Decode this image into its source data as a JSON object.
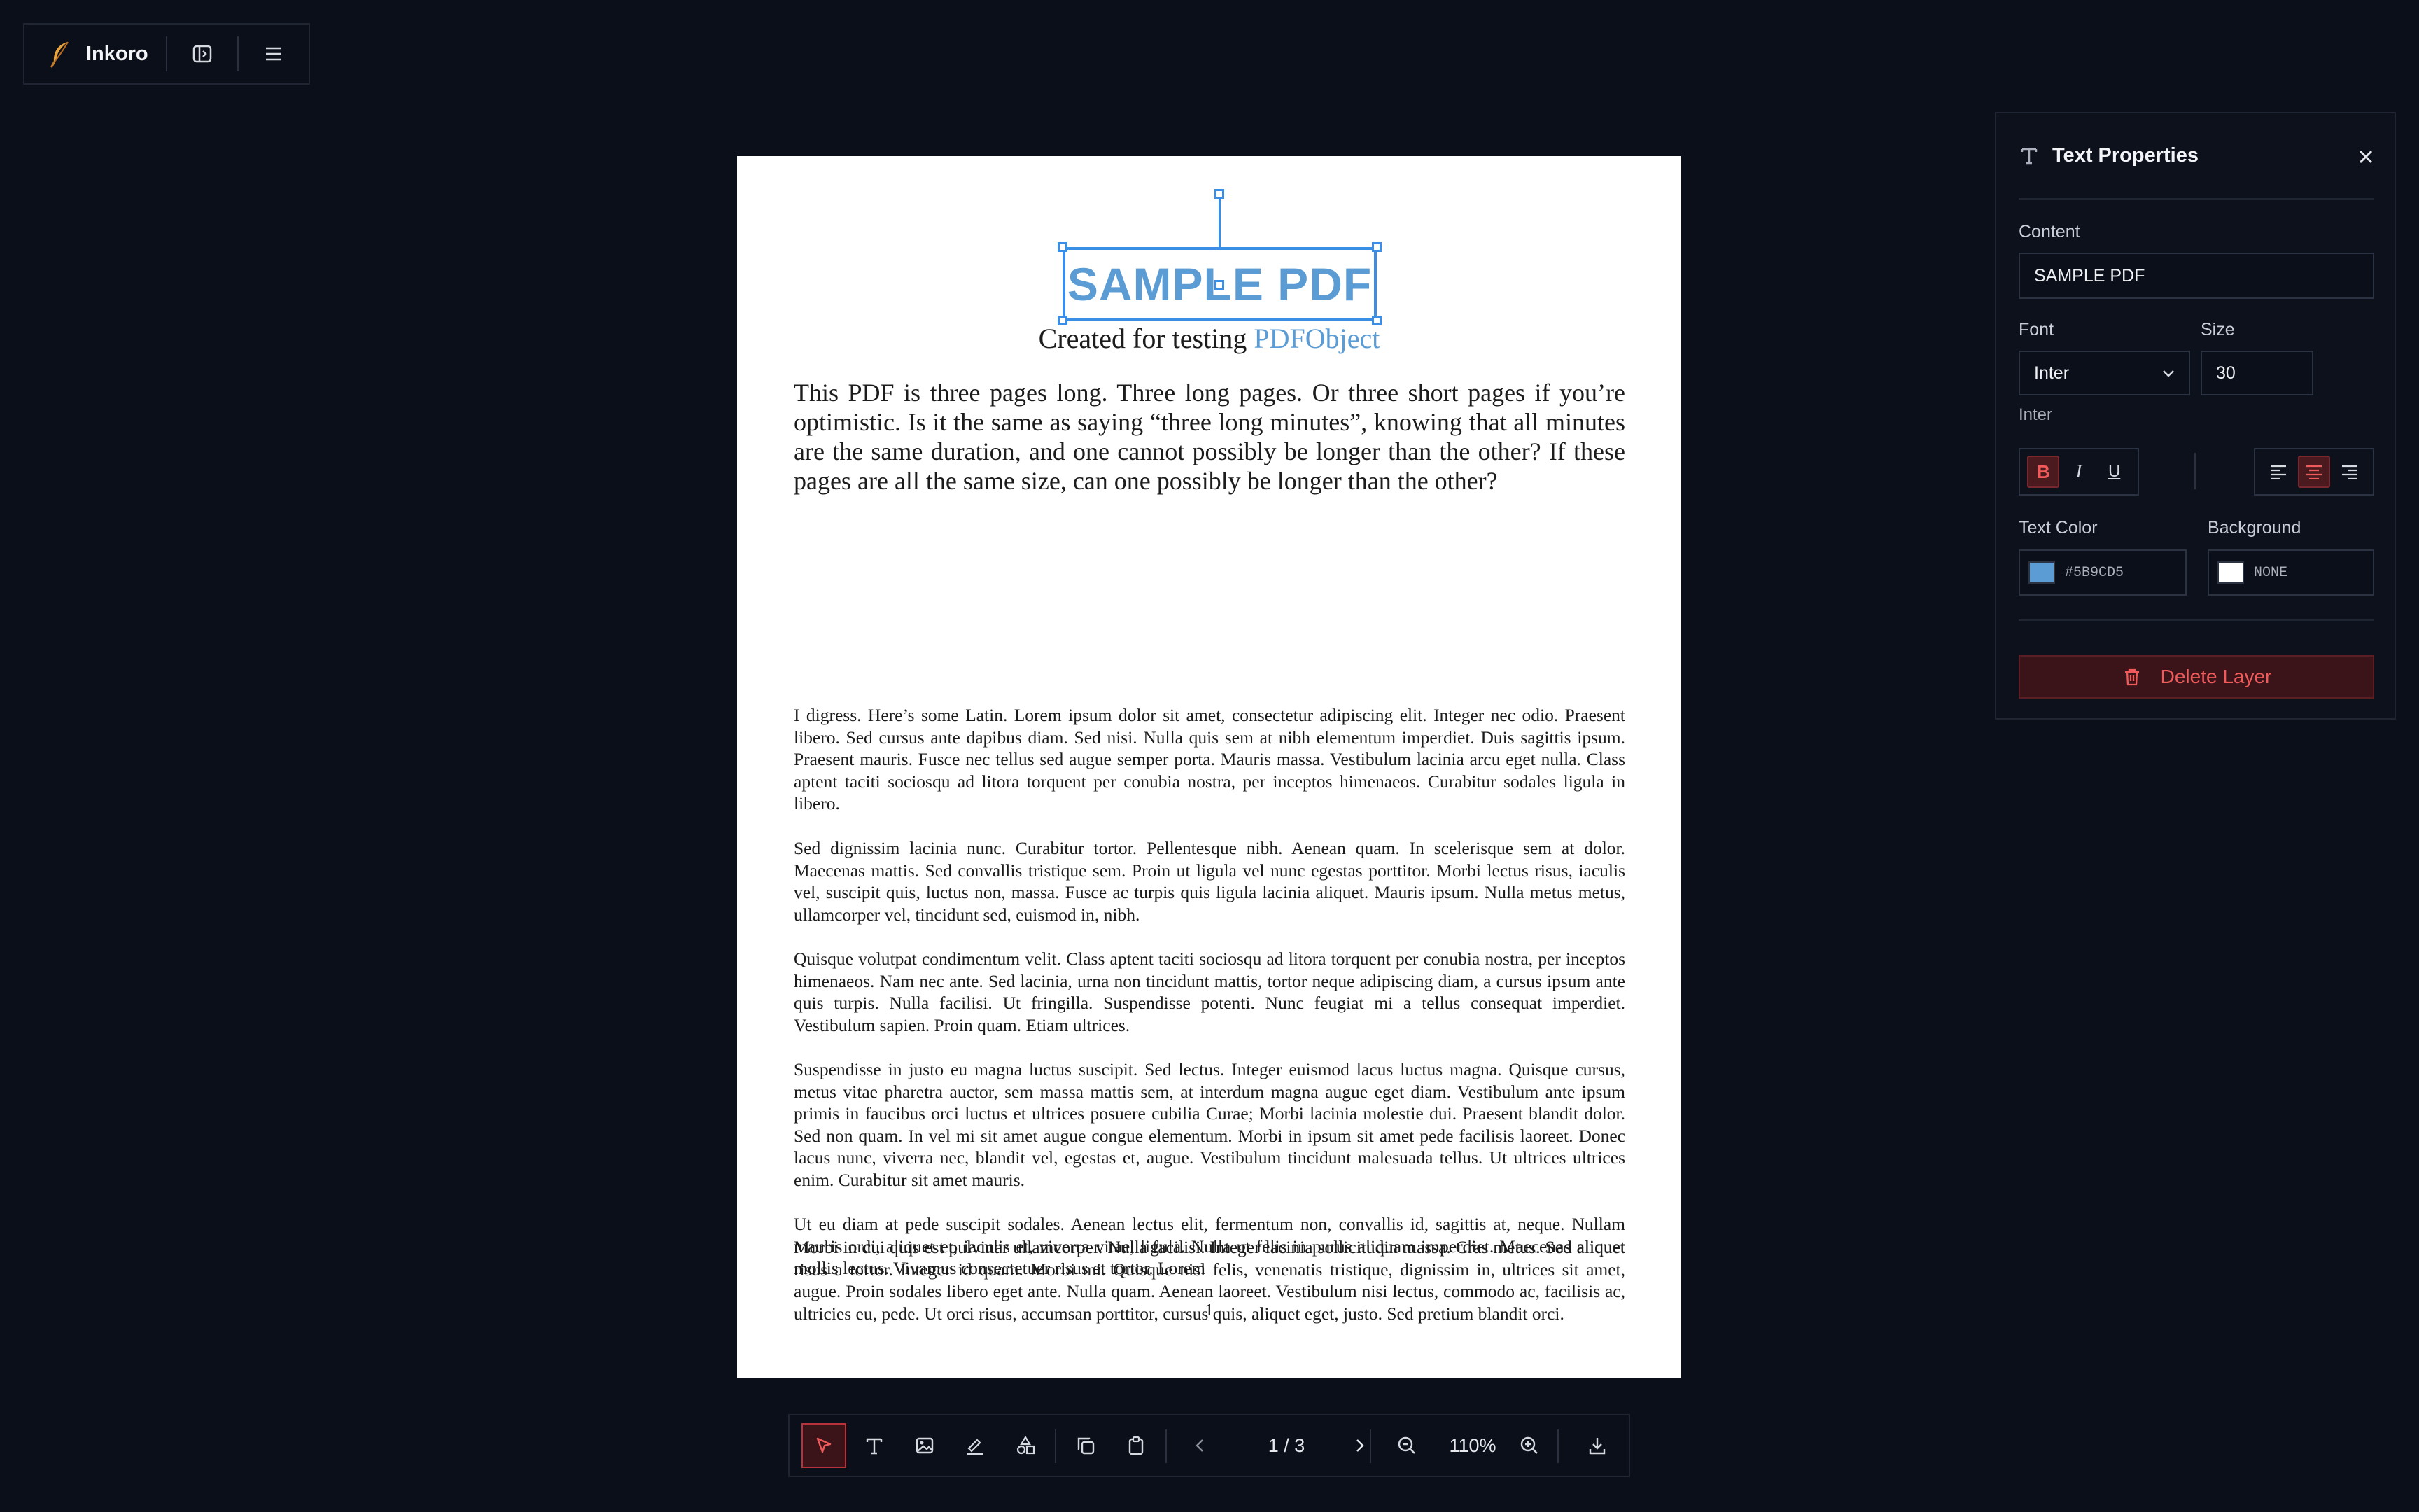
{
  "app": {
    "name": "Inkoro"
  },
  "document": {
    "title_layer_text": "SAMPLE PDF",
    "subtitle_prefix": "Created for testing ",
    "subtitle_link": "PDFObject",
    "lead": "This PDF is three pages long. Three long pages. Or three short pages if you’re optimistic. Is it the same as saying “three long minutes”, knowing that all minutes are the same duration, and one cannot possibly be longer than the other? If these pages are all the same size, can one possibly be longer than the other?",
    "paragraphs": [
      "I digress. Here’s some Latin. Lorem ipsum dolor sit amet, consectetur adipiscing elit. Integer nec odio. Praesent libero. Sed cursus ante dapibus diam. Sed nisi. Nulla quis sem at nibh elementum imperdiet. Duis sagittis ipsum. Praesent mauris. Fusce nec tellus sed augue semper porta. Mauris massa. Vestibulum lacinia arcu eget nulla. Class aptent taciti sociosqu ad litora torquent per conubia nostra, per inceptos himenaeos. Curabitur sodales ligula in libero.",
      "Sed dignissim lacinia nunc. Curabitur tortor. Pellentesque nibh. Aenean quam. In scelerisque sem at dolor. Maecenas mattis. Sed convallis tristique sem. Proin ut ligula vel nunc egestas porttitor. Morbi lectus risus, iaculis vel, suscipit quis, luctus non, massa. Fusce ac turpis quis ligula lacinia aliquet. Mauris ipsum. Nulla metus metus, ullamcorper vel, tincidunt sed, euismod in, nibh.",
      "Quisque volutpat condimentum velit. Class aptent taciti sociosqu ad litora torquent per conubia nostra, per inceptos himenaeos. Nam nec ante. Sed lacinia, urna non tincidunt mattis, tortor neque adipiscing diam, a cursus ipsum ante quis turpis. Nulla facilisi. Ut fringilla. Suspendisse potenti. Nunc feugiat mi a tellus consequat imperdiet. Vestibulum sapien. Proin quam. Etiam ultrices.",
      "Suspendisse in justo eu magna luctus suscipit. Sed lectus. Integer euismod lacus luctus magna. Quisque cursus, metus vitae pharetra auctor, sem massa mattis sem, at interdum magna augue eget diam. Vestibulum ante ipsum primis in faucibus orci luctus et ultrices posuere cubilia Curae; Morbi lacinia molestie dui. Praesent blandit dolor. Sed non quam. In vel mi sit amet augue congue elementum. Morbi in ipsum sit amet pede facilisis laoreet. Donec lacus nunc, viverra nec, blandit vel, egestas et, augue. Vestibulum tincidunt malesuada tellus. Ut ultrices ultrices enim. Curabitur sit amet mauris.",
      "Morbi in dui quis est pulvinar ullamcorper. Nulla facilisi. Integer lacinia sollicitudin massa. Cras metus. Sed aliquet risus a tortor. Integer id quam. Morbi mi. Quisque nisl felis, venenatis tristique, dignissim in, ultrices sit amet, augue. Proin sodales libero eget ante. Nulla quam. Aenean laoreet. Vestibulum nisi lectus, commodo ac, facilisis ac, ultricies eu, pede. Ut orci risus, accumsan porttitor, cursus quis, aliquet eget, justo. Sed pretium blandit orci.",
      "Ut eu diam at pede suscipit sodales. Aenean lectus elit, fermentum non, convallis id, sagittis at, neque. Nullam mauris orci, aliquet et, iaculis et, viverra vitae, ligula. Nulla ut felis in purus aliquam imperdiet. Maecenas aliquet mollis lectus. Vivamus consectetuer risus et tortor. Lorem"
    ],
    "page_number": "1"
  },
  "panel": {
    "title": "Text Properties",
    "content_label": "Content",
    "content_value": "SAMPLE PDF",
    "font_label": "Font",
    "font_value": "Inter",
    "size_label": "Size",
    "size_value": "30",
    "font_preview": "Inter",
    "style_buttons": {
      "bold": "B",
      "italic": "I",
      "underline": "U",
      "bold_active": true
    },
    "align_active": "center",
    "text_color_label": "Text Color",
    "text_color_value": "#5B9CD5",
    "background_label": "Background",
    "background_value": "NONE",
    "delete_label": "Delete Layer"
  },
  "toolbar": {
    "page_indicator": "1 / 3",
    "zoom": "110%",
    "active_tool": "select"
  },
  "colors": {
    "accent": "#b8323c",
    "text_layer": "#5B9CD5",
    "selection": "#3a8ee6",
    "delete": "#ef5a5a"
  }
}
